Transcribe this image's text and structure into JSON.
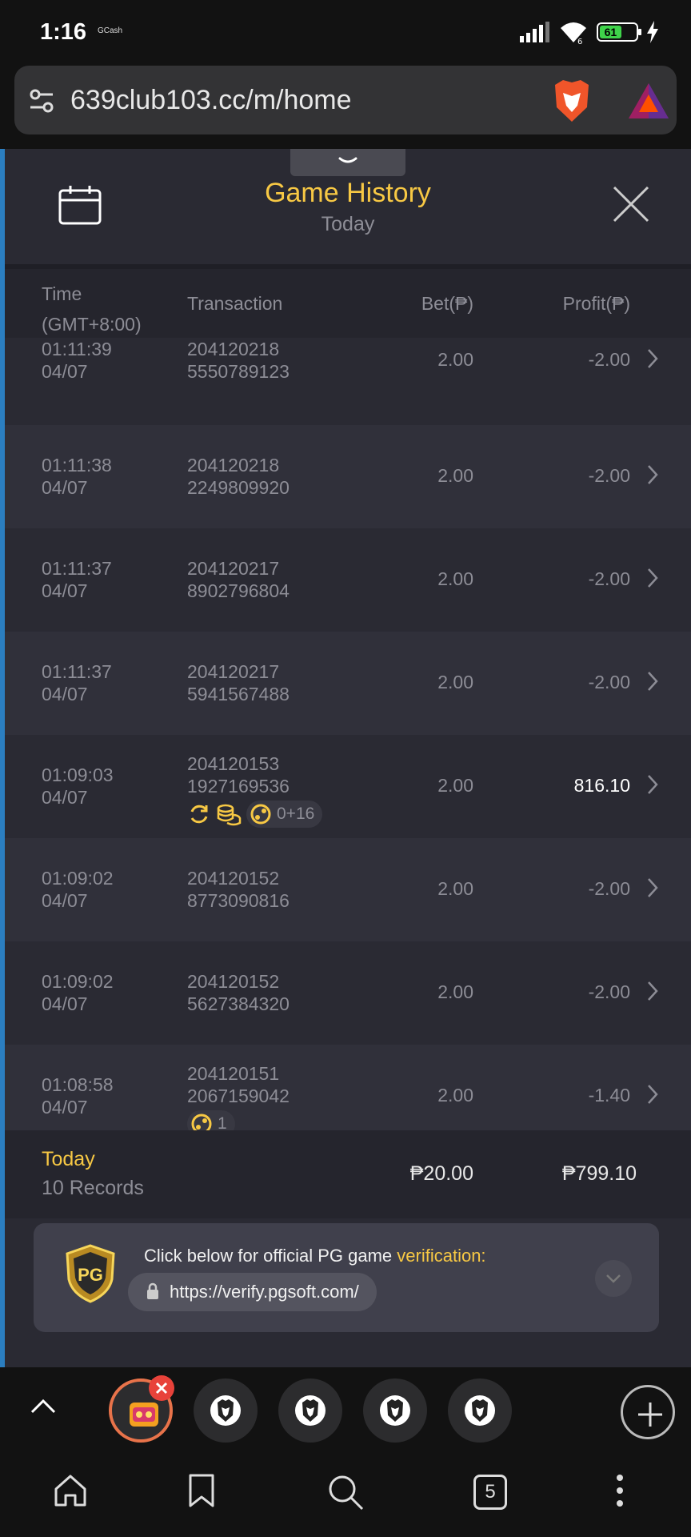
{
  "status_bar": {
    "time": "1:16",
    "carrier_tag": "GCash",
    "battery": "61",
    "icons": [
      "signal-icon",
      "wifi-icon",
      "battery-icon",
      "charging-icon"
    ]
  },
  "browser": {
    "url": "639club103.cc/m/home",
    "icons": [
      "tune-icon",
      "brave-shields-icon",
      "brave-rewards-icon"
    ]
  },
  "header": {
    "title": "Game History",
    "subtitle": "Today",
    "icons": [
      "calendar-icon",
      "close-icon"
    ]
  },
  "columns": {
    "time_line1": "Time",
    "time_line2": "(GMT+8:00)",
    "transaction": "Transaction",
    "bet": "Bet(₱)",
    "profit": "Profit(₱)"
  },
  "rows": [
    {
      "time": "01:11:39",
      "date": "04/07",
      "tx1": "204120218",
      "tx2": "5550789123",
      "bet": "2.00",
      "profit": "-2.00"
    },
    {
      "time": "01:11:38",
      "date": "04/07",
      "tx1": "204120218",
      "tx2": "2249809920",
      "bet": "2.00",
      "profit": "-2.00"
    },
    {
      "time": "01:11:37",
      "date": "04/07",
      "tx1": "204120217",
      "tx2": "8902796804",
      "bet": "2.00",
      "profit": "-2.00"
    },
    {
      "time": "01:11:37",
      "date": "04/07",
      "tx1": "204120217",
      "tx2": "5941567488",
      "bet": "2.00",
      "profit": "-2.00"
    },
    {
      "time": "01:09:03",
      "date": "04/07",
      "tx1": "204120153",
      "tx2": "1927169536",
      "bet": "2.00",
      "profit": "816.10",
      "badge": "0+16"
    },
    {
      "time": "01:09:02",
      "date": "04/07",
      "tx1": "204120152",
      "tx2": "8773090816",
      "bet": "2.00",
      "profit": "-2.00"
    },
    {
      "time": "01:09:02",
      "date": "04/07",
      "tx1": "204120152",
      "tx2": "5627384320",
      "bet": "2.00",
      "profit": "-2.00"
    },
    {
      "time": "01:08:58",
      "date": "04/07",
      "tx1": "204120151",
      "tx2": "2067159042",
      "bet": "2.00",
      "profit": "-1.40",
      "badge": "1"
    }
  ],
  "summary": {
    "label": "Today",
    "records": "10 Records",
    "bet_total": "₱20.00",
    "profit_total": "₱799.10"
  },
  "verification": {
    "text": "Click below for official PG game ",
    "highlight": "verification:",
    "link": "https://verify.pgsoft.com/",
    "logo_text": "PG"
  },
  "tabs": {
    "count": "5"
  },
  "colors": {
    "accent_gold": "#f7c844",
    "page_bg": "#2a2a33",
    "active_tab_ring": "#e8734a",
    "close_badge": "#e8423a"
  }
}
